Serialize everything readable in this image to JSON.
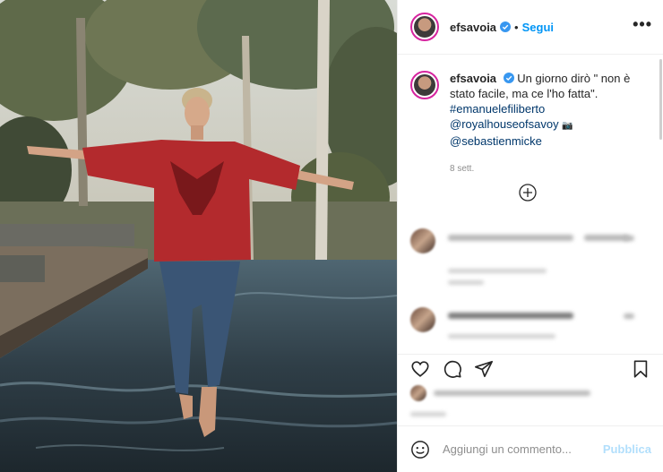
{
  "post": {
    "photo_alt": "",
    "header": {
      "username": "efsavoia",
      "separator": "•",
      "follow_label": "Segui",
      "more_label": "•••"
    },
    "caption": {
      "username": "efsavoia",
      "text": "Un giorno dirò \" non è stato facile, ma ce l'ho fatta\".",
      "hashtag": "#emanuelefiliberto",
      "mention1": "@royalhouseofsavoy",
      "camera_emoji": "📷",
      "mention2": "@sebastienmicke",
      "timestamp": "8 sett."
    },
    "comment_box": {
      "placeholder": "Aggiungi un commento...",
      "publish_label": "Pubblica"
    },
    "icons": [
      "verified-badge-icon",
      "heart-icon",
      "comment-icon",
      "share-icon",
      "bookmark-icon",
      "plus-circle-icon",
      "emoji-icon",
      "more-icon"
    ],
    "colors": {
      "accent": "#0095f6",
      "link": "#00376b",
      "publish_disabled": "#b2dffc",
      "sweater": "#b32a2d"
    }
  }
}
